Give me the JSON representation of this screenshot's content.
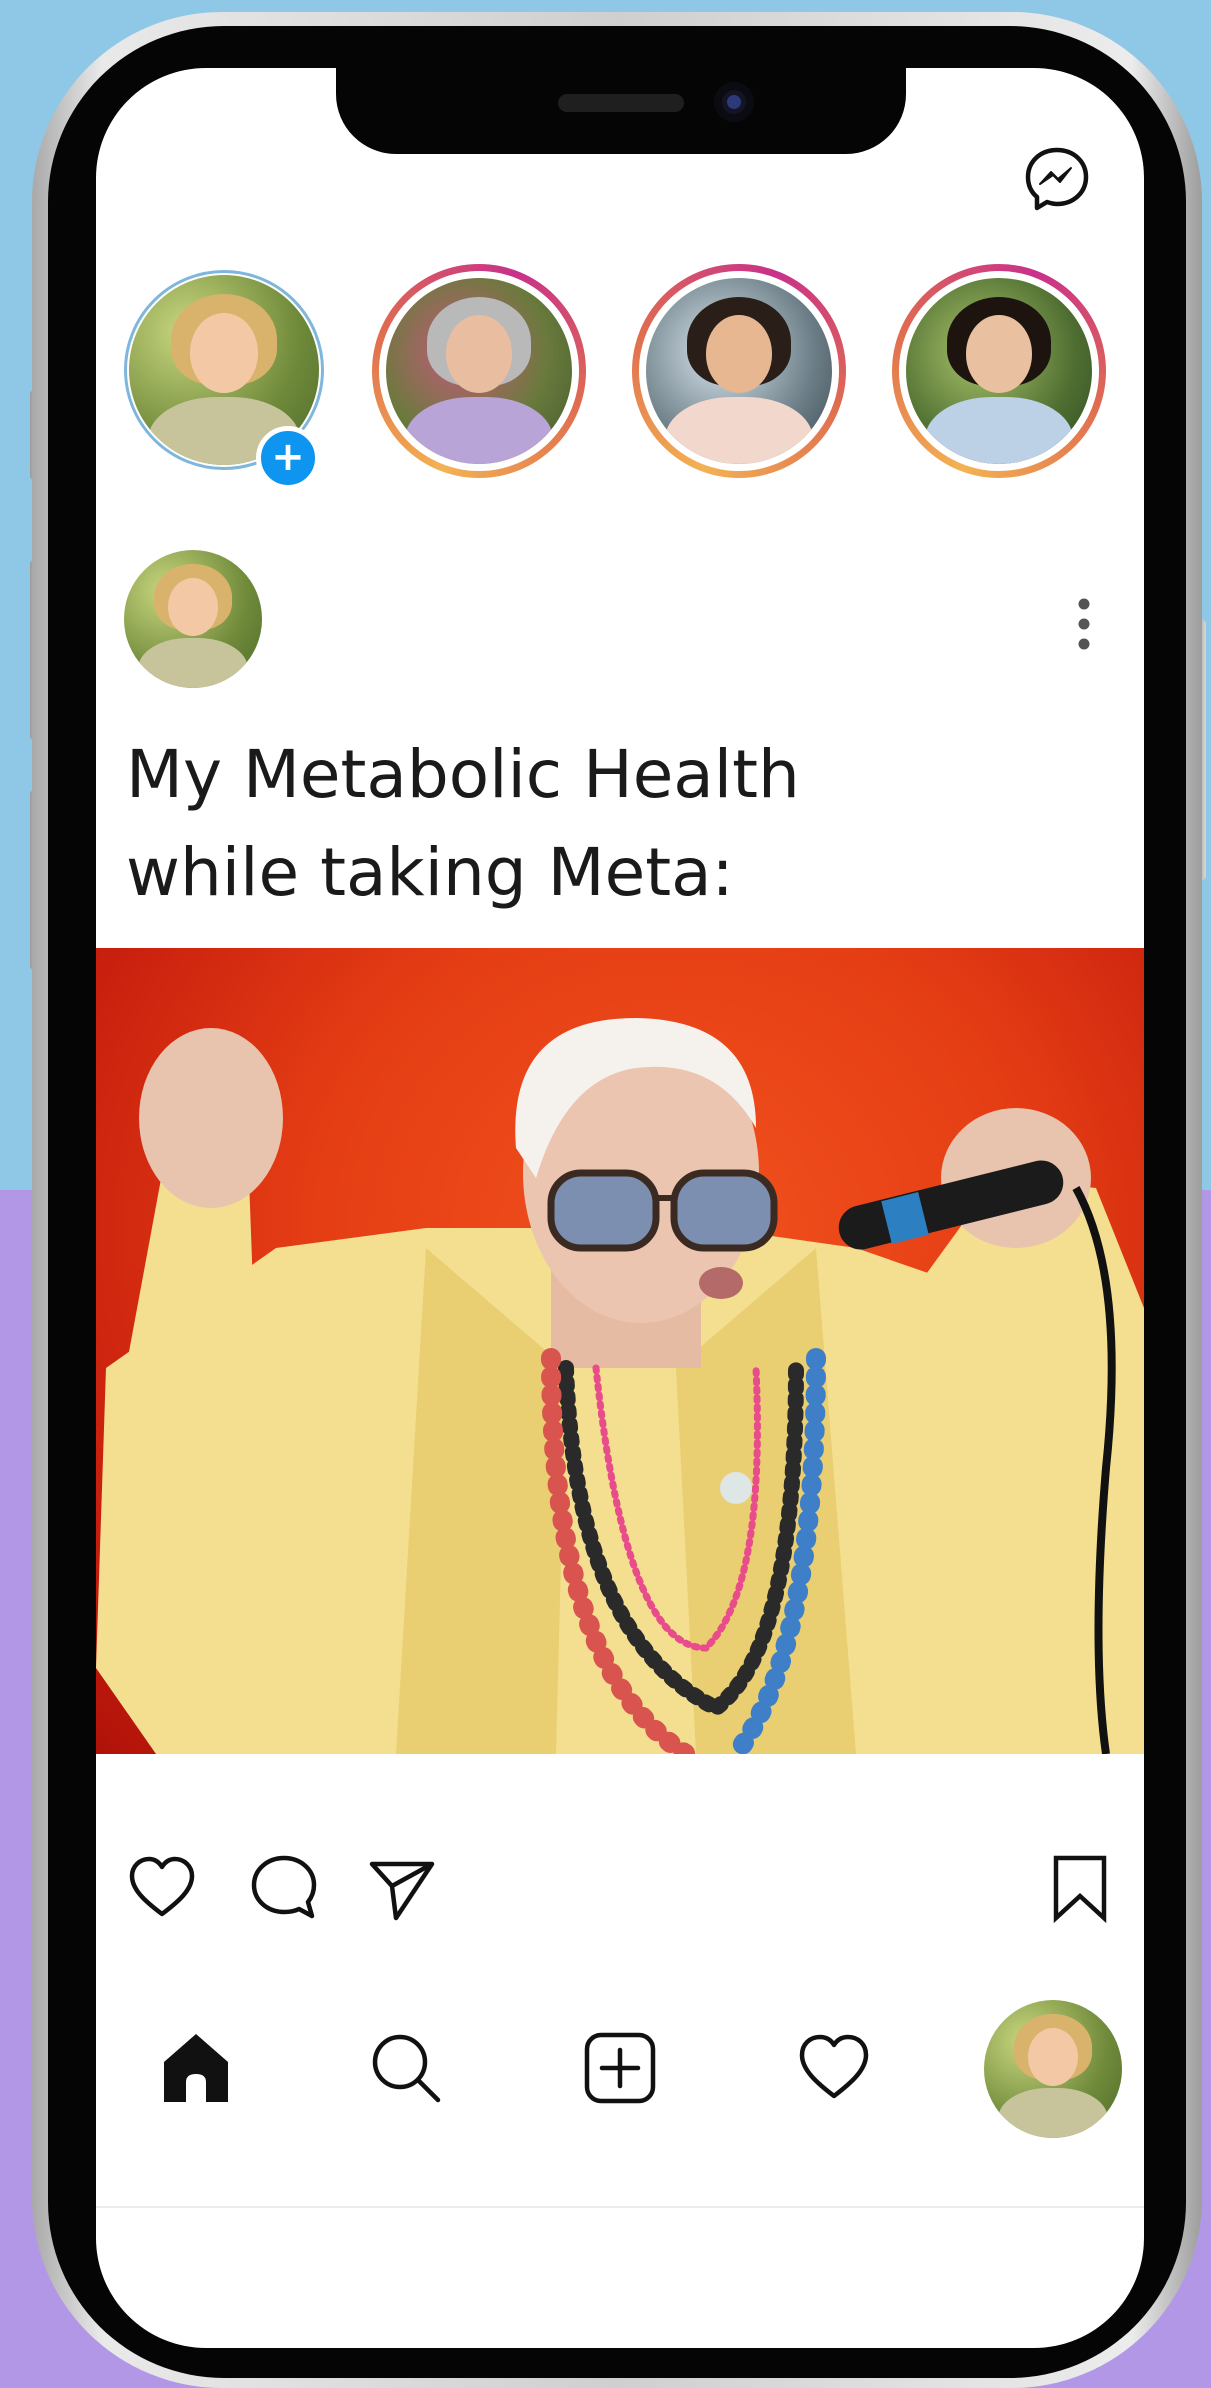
{
  "post": {
    "caption_line1": "My Metabolic Health",
    "caption_line2": "while taking Meta:"
  },
  "icons": {
    "header": "messenger-icon",
    "story_badge": "plus-icon",
    "post_menu": "more-vertical-icon",
    "actions": [
      "heart-icon",
      "comment-icon",
      "send-icon",
      "bookmark-icon"
    ],
    "nav": [
      "home-icon",
      "search-icon",
      "add-post-icon",
      "heart-icon",
      "profile-avatar"
    ]
  },
  "colors": {
    "accent_blue": "#0d95f0",
    "story_ring_start": "#f3b253",
    "story_ring_end": "#c8318b",
    "post_background": "#e43d14"
  }
}
